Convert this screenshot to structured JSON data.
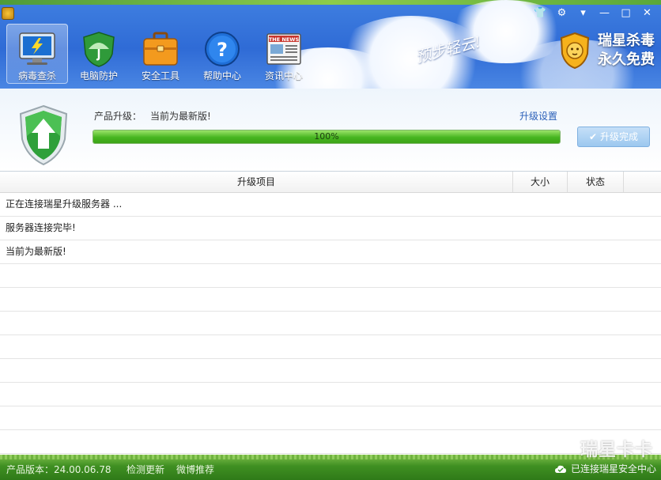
{
  "nav": {
    "items": [
      {
        "label": "病毒查杀",
        "icon": "monitor-lightning-icon",
        "active": true
      },
      {
        "label": "电脑防护",
        "icon": "umbrella-shield-icon",
        "active": false
      },
      {
        "label": "安全工具",
        "icon": "toolbox-icon",
        "active": false
      },
      {
        "label": "帮助中心",
        "icon": "question-icon",
        "active": false
      },
      {
        "label": "资讯中心",
        "icon": "newspaper-icon",
        "active": false
      }
    ]
  },
  "header": {
    "slogan": "预步轻云!",
    "brand_line1": "瑞星杀毒",
    "brand_line2": "永久免费",
    "news_icon_text": "THE NEWS"
  },
  "window_controls": {
    "skin": "👕",
    "settings": "⚙",
    "menu": "▾",
    "minimize": "—",
    "maximize": "□",
    "close": "✕"
  },
  "upgrade": {
    "label": "产品升级：",
    "status": "当前为最新版!",
    "settings_link": "升级设置",
    "progress_percent": 100,
    "progress_text": "100%",
    "done_button": "升级完成"
  },
  "table": {
    "headers": [
      "升级项目",
      "大小",
      "状态"
    ],
    "rows": [
      "正在连接瑞星升级服务器 ...",
      "服务器连接完毕!",
      "当前为最新版!",
      "",
      "",
      "",
      "",
      "",
      "",
      "",
      ""
    ]
  },
  "footer": {
    "version": "产品版本：24.00.06.78",
    "check_update": "检测更新",
    "weibo": "微博推荐",
    "connection": "已连接瑞星安全中心"
  },
  "watermark": "瑞星卡卡",
  "colors": {
    "header_blue": "#2f6bd6",
    "progress_green": "#46b520",
    "link_blue": "#2a5fb8",
    "footer_green": "#3f8f22"
  }
}
